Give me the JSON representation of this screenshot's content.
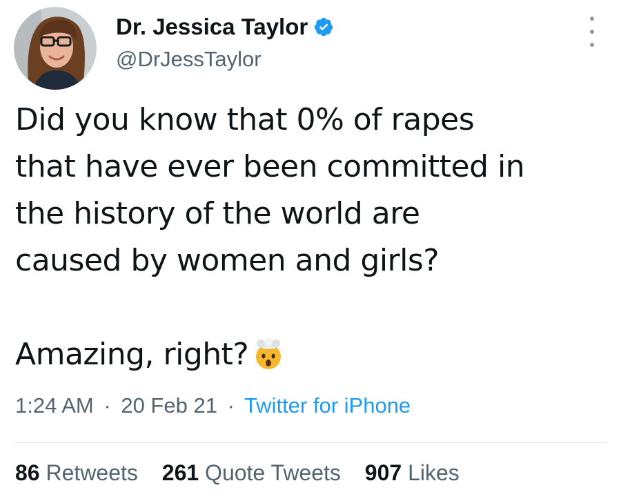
{
  "author": {
    "display_name": "Dr. Jessica Taylor",
    "handle": "@DrJessTaylor",
    "avatar_icon": "profile-photo",
    "verified_icon": "verified-badge-icon",
    "verified_color": "#1d9bf0"
  },
  "more_icon": "more-options-icon",
  "tweet": {
    "lines": [
      "Did you know that 0% of rapes",
      "that have ever been committed in",
      "the history of the world are",
      "caused by women and girls?"
    ],
    "closing": "Amazing, right?",
    "emoji": "exploding-head-emoji"
  },
  "meta": {
    "time": "1:24 AM",
    "separator": "·",
    "date": "20 Feb 21",
    "source": "Twitter for iPhone"
  },
  "stats": {
    "retweets": {
      "count": "86",
      "label": "Retweets"
    },
    "quote_tweets": {
      "count": "261",
      "label": "Quote Tweets"
    },
    "likes": {
      "count": "907",
      "label": "Likes"
    }
  },
  "colors": {
    "text": "#0f1419",
    "secondary": "#536471",
    "link": "#1d9bf0"
  }
}
